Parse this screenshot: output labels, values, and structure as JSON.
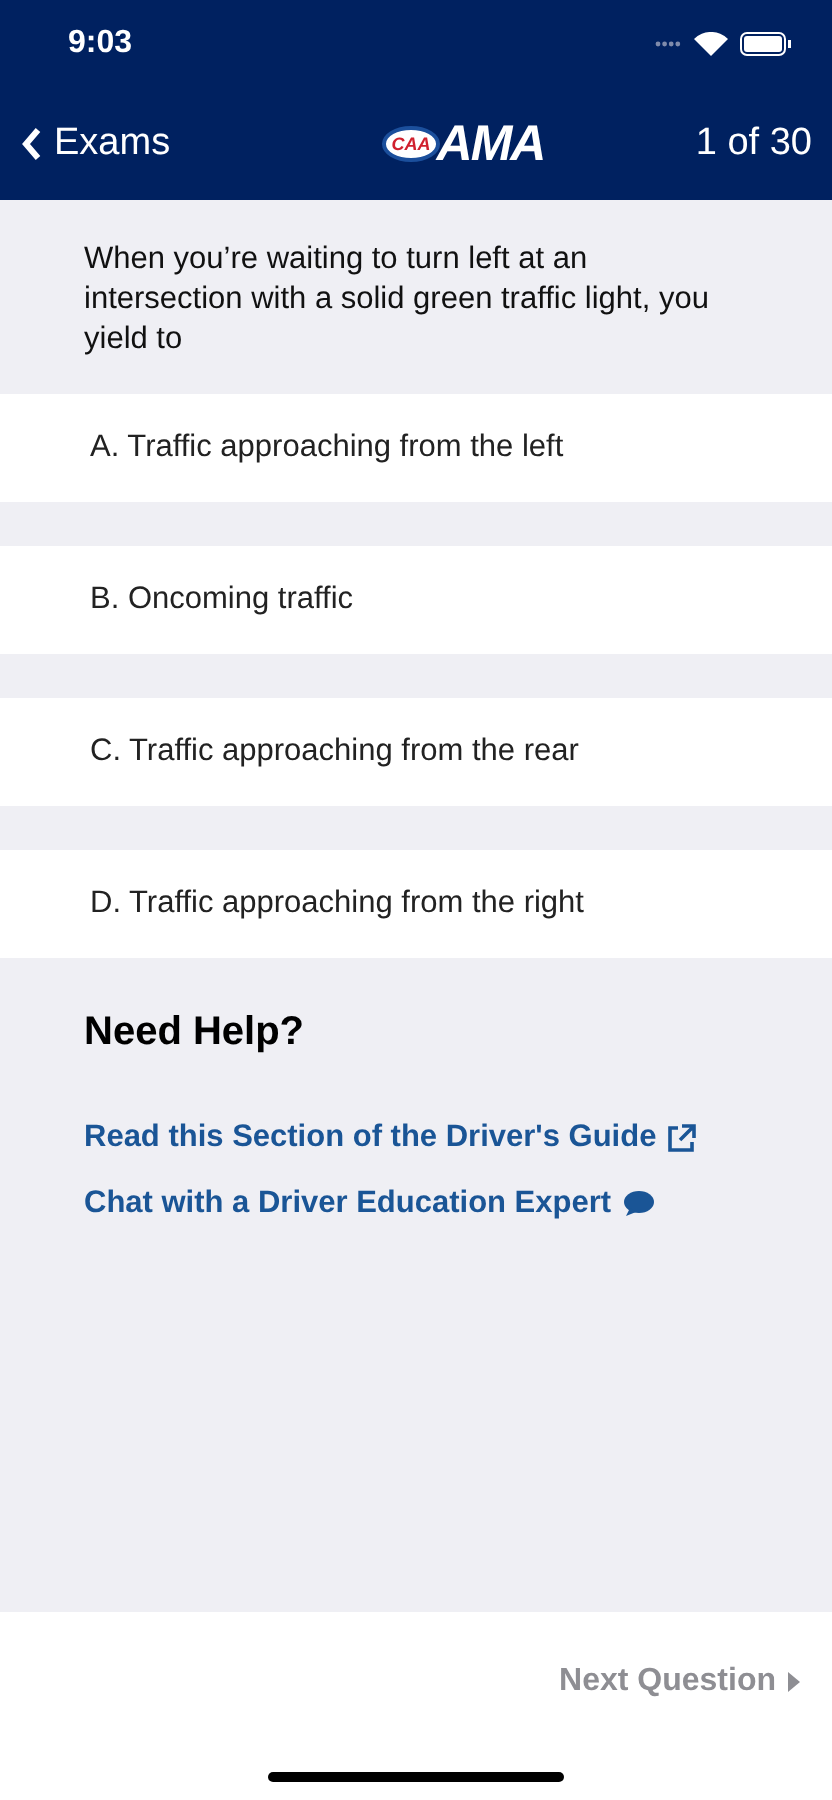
{
  "status_bar": {
    "time": "9:03"
  },
  "nav": {
    "back": "Exams",
    "logo_badge": "CAA",
    "logo": "AMA",
    "progress": "1 of 30"
  },
  "question": "When you’re waiting to turn left at an intersection with a solid green traffic light, you yield to",
  "answers": [
    {
      "label": "A. Traffic approaching from the left",
      "selected": false
    },
    {
      "label": "B. Oncoming traffic",
      "selected": false
    },
    {
      "label": "C. Traffic approaching from the rear",
      "selected": false
    },
    {
      "label": "D. Traffic approaching from the right",
      "selected": false
    }
  ],
  "help": {
    "title": "Need Help?",
    "links": [
      {
        "label": "Read this Section of the Driver's Guide",
        "kind": "external"
      },
      {
        "label": "Chat with a Driver Education Expert",
        "kind": "chat"
      }
    ]
  },
  "footer": {
    "next": "Next Question",
    "disabled": true
  }
}
